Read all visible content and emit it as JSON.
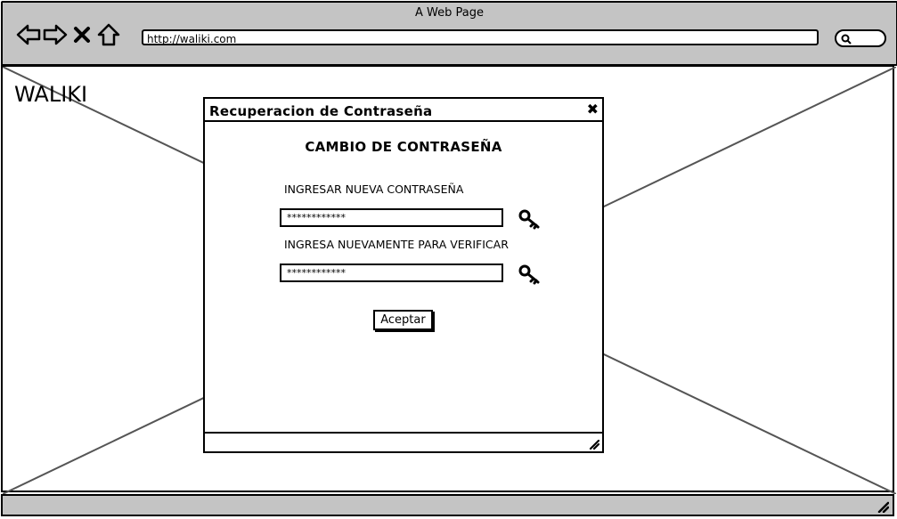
{
  "browser": {
    "title": "A Web Page",
    "url": "http://waliki.com"
  },
  "page": {
    "logo": "WALIKI"
  },
  "dialog": {
    "title": "Recuperacion de Contraseña",
    "heading": "CAMBIO DE CONTRASEÑA",
    "new_password_label": "INGRESAR NUEVA CONTRASEÑA",
    "new_password_value": "************",
    "verify_label": "INGRESA NUEVAMENTE PARA VERIFICAR",
    "verify_value": "************",
    "accept_label": "Aceptar",
    "close_glyph": "✖"
  }
}
